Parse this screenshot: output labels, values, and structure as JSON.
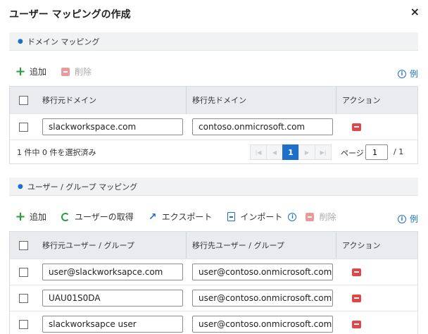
{
  "dialog": {
    "title": "ユーザー マッピングの作成",
    "close": "×"
  },
  "domain_section": {
    "header": "ドメイン マッピング",
    "toolbar": {
      "add_label": "追加",
      "delete_label": "削除",
      "example_label": "例"
    },
    "table": {
      "columns": [
        "移行元ドメイン",
        "移行先ドメイン",
        "アクション"
      ],
      "rows": [
        {
          "source": "slackworkspace.com",
          "target": "contoso.onmicrosoft.com"
        }
      ]
    },
    "footer": {
      "selection_text": "1 件中 0 件を選択済み",
      "page_current": "1",
      "page_label": "ページ",
      "page_input": "1",
      "page_total": "/ 1"
    }
  },
  "user_section": {
    "header": "ユーザー / グループ マッピング",
    "toolbar": {
      "add_label": "追加",
      "get_users_label": "ユーザーの取得",
      "export_label": "エクスポート",
      "import_label": "インポート",
      "delete_label": "削除",
      "example_label": "例"
    },
    "table": {
      "columns": [
        "移行元ユーザー / グループ",
        "移行先ユーザー / グループ",
        "アクション"
      ],
      "rows": [
        {
          "source": "user@slackworksapce.com",
          "target": "user@contoso.onmicrosoft.com"
        },
        {
          "source": "UAU01S0DA",
          "target": "user@contoso.onmicrosoft.com"
        },
        {
          "source": "slackworksapce user",
          "target": "user@contoso.onmicrosoft.com"
        }
      ]
    }
  },
  "icons": {
    "info": "i",
    "plus": "+",
    "export": "↗",
    "first": "|◀",
    "prev": "◀",
    "next": "▶",
    "last": "▶|"
  },
  "colors": {
    "accent": "#1e6fc8",
    "add_green": "#2a9d3c",
    "remove_red": "#e04646",
    "header_bg": "#f1f2f4"
  }
}
